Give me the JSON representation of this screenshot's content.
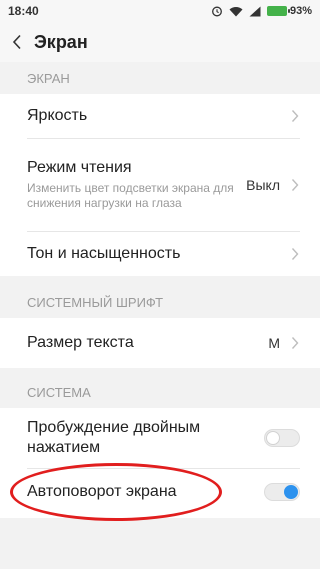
{
  "status": {
    "time": "18:40",
    "battery": "93%"
  },
  "header": {
    "title": "Экран"
  },
  "sections": {
    "screen": "ЭКРАН",
    "font": "СИСТЕМНЫЙ ШРИФТ",
    "system": "СИСТЕМА"
  },
  "rows": {
    "brightness": {
      "label": "Яркость"
    },
    "reading": {
      "label": "Режим чтения",
      "sub": "Изменить цвет подсветки экрана для снижения нагрузки на глаза",
      "value": "Выкл"
    },
    "tone": {
      "label": "Тон и насыщенность"
    },
    "text_size": {
      "label": "Размер текста",
      "value": "M"
    },
    "double_tap": {
      "label": "Пробуждение двойным нажатием",
      "enabled": false
    },
    "autorotate": {
      "label": "Автоповорот экрана",
      "enabled": true
    }
  },
  "colors": {
    "accent": "#2d92ee",
    "annotation": "#e11e1e",
    "battery": "#44b24a"
  },
  "icons": [
    "back-arrow-icon",
    "chevron-right-icon",
    "alarm-icon",
    "wifi-icon",
    "signal-icon",
    "battery-icon"
  ]
}
